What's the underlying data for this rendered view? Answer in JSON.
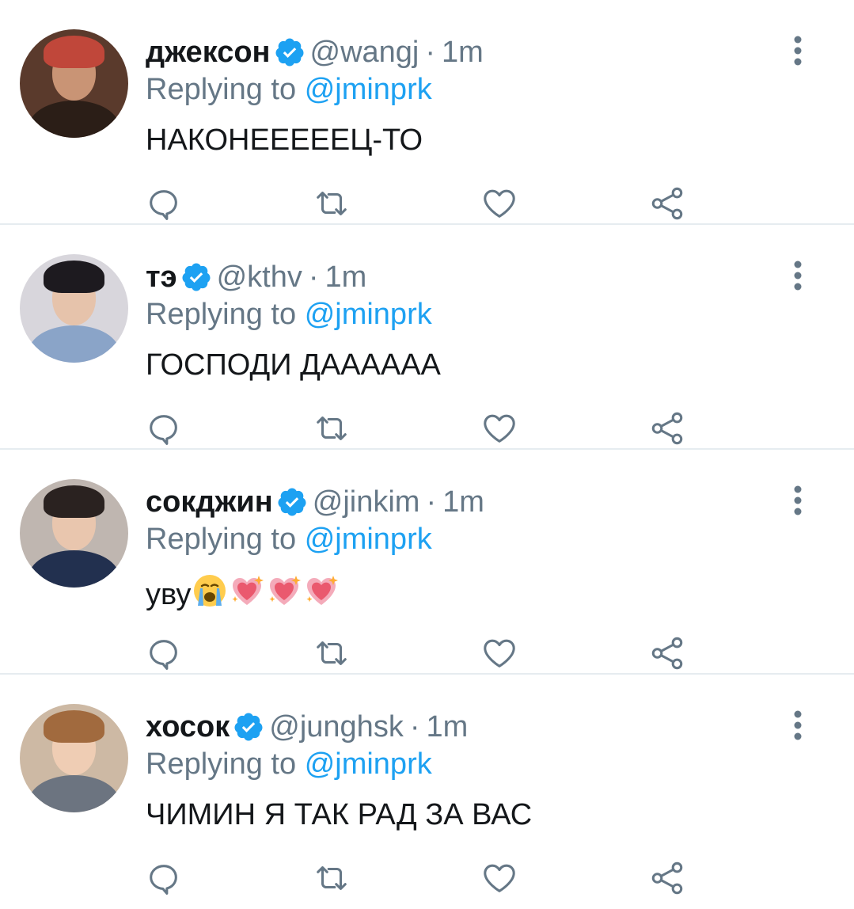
{
  "reply_prefix": "Replying to",
  "colors": {
    "name": "#14171a",
    "secondary": "#657786",
    "link": "#1da1f2",
    "verified": "#1da1f2",
    "action_icon": "#657786",
    "divider": "#e6ecf0"
  },
  "action_icons": [
    "reply-icon",
    "retweet-icon",
    "like-icon",
    "share-icon"
  ],
  "tweets": [
    {
      "name": "джексон",
      "handle": "@wangj",
      "time": "1m",
      "reply_to": "@jminprk",
      "text": "НАКОНЕЕЕЕЕЦ-ТО",
      "emojis": []
    },
    {
      "name": "тэ",
      "handle": "@kthv",
      "time": "1m",
      "reply_to": "@jminprk",
      "text": "ГОСПОДИ ДАААААА",
      "emojis": []
    },
    {
      "name": "сокджин",
      "handle": "@jinkim",
      "time": "1m",
      "reply_to": "@jminprk",
      "text": "уву",
      "emojis": [
        "crying-face-emoji",
        "sparkling-heart-emoji",
        "sparkling-heart-emoji",
        "sparkling-heart-emoji"
      ]
    },
    {
      "name": "хосок",
      "handle": "@junghsk",
      "time": "1m",
      "reply_to": "@jminprk",
      "text": "ЧИМИН Я ТАК РАД ЗА ВАС",
      "emojis": []
    }
  ]
}
